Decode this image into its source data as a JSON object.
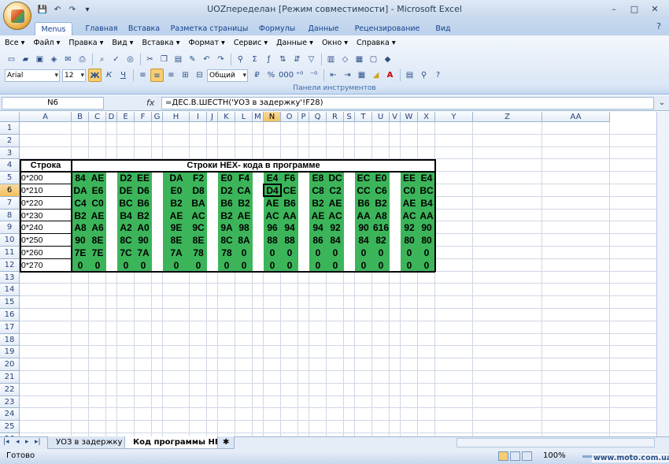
{
  "window": {
    "title": "UOZпеределан  [Режим совместимости] - Microsoft Excel",
    "minimize": "–",
    "maximize": "□",
    "close": "✕"
  },
  "qat": [
    "💾",
    "↶",
    "↷",
    "▾"
  ],
  "ribbon": {
    "tabs": [
      "Menus",
      "Главная",
      "Вставка",
      "Разметка страницы",
      "Формулы",
      "Данные",
      "Рецензирование",
      "Вид"
    ],
    "active_tab": "Menus",
    "help": "?",
    "menus": [
      "Все ▾",
      "Файл ▾",
      "Правка ▾",
      "Вид ▾",
      "Вставка ▾",
      "Формат ▾",
      "Сервис ▾",
      "Данные ▾",
      "Окно ▾",
      "Справка ▾"
    ],
    "font_name": "Arial",
    "font_size": "12",
    "number_format": "Общий",
    "group_label": "Панели инструментов"
  },
  "formula_bar": {
    "name_box": "N6",
    "fx": "fx",
    "formula": "=ДЕС.В.ШЕСТН('УОЗ в задержку'!F28)"
  },
  "grid": {
    "columns": [
      "A",
      "B",
      "C",
      "D",
      "E",
      "F",
      "G",
      "H",
      "I",
      "J",
      "K",
      "L",
      "M",
      "N",
      "O",
      "P",
      "Q",
      "R",
      "S",
      "T",
      "U",
      "V",
      "W",
      "X",
      "Y",
      "Z",
      "AA"
    ],
    "selected_column": "N",
    "rows": [
      "1",
      "2",
      "3",
      "4",
      "5",
      "6",
      "7",
      "8",
      "9",
      "10",
      "11",
      "12",
      "13",
      "14",
      "15",
      "16",
      "17",
      "18",
      "19",
      "20",
      "21",
      "22",
      "23",
      "24",
      "25",
      "26"
    ],
    "selected_row": "6",
    "header_row_label": "Строка",
    "header_title": "Строки HEX- кода в программе",
    "row_labels": [
      "0*200",
      "0*210",
      "0*220",
      "0*230",
      "0*240",
      "0*250",
      "0*260",
      "0*270"
    ],
    "hex_rows": [
      [
        "84",
        "AE",
        "D2",
        "EE",
        "DA",
        "F2",
        "E0",
        "F4",
        "E4",
        "F6",
        "E8",
        "DC",
        "EC",
        "E0",
        "EE",
        "E4"
      ],
      [
        "DA",
        "E6",
        "DE",
        "D6",
        "E0",
        "D8",
        "D2",
        "CA",
        "D4",
        "CE",
        "C8",
        "C2",
        "CC",
        "C6",
        "C0",
        "BC"
      ],
      [
        "C4",
        "C0",
        "BC",
        "B6",
        "B2",
        "BA",
        "B6",
        "B2",
        "AE",
        "B6",
        "B2",
        "AE",
        "B6",
        "B2",
        "AE",
        "B4"
      ],
      [
        "B2",
        "AE",
        "B4",
        "B2",
        "AE",
        "AC",
        "B2",
        "AE",
        "AC",
        "AA",
        "AE",
        "AC",
        "AA",
        "A8",
        "AC",
        "AA"
      ],
      [
        "A8",
        "A6",
        "A2",
        "A0",
        "9E",
        "9C",
        "9A",
        "98",
        "96",
        "94",
        "94",
        "92",
        "90",
        "616",
        "92",
        "90"
      ],
      [
        "90",
        "8E",
        "8C",
        "90",
        "8E",
        "8E",
        "8C",
        "8A",
        "88",
        "88",
        "86",
        "84",
        "84",
        "82",
        "80",
        "80"
      ],
      [
        "7E",
        "7E",
        "7C",
        "7A",
        "7A",
        "78",
        "78",
        "0",
        "0",
        "0",
        "0",
        "0",
        "0",
        "0",
        "0",
        "0"
      ],
      [
        "0",
        "0",
        "0",
        "0",
        "0",
        "0",
        "0",
        "0",
        "0",
        "0",
        "0",
        "0",
        "0",
        "0",
        "0",
        "0"
      ]
    ],
    "fill_color": "#3cb55a"
  },
  "sheets": {
    "tabs": [
      "УОЗ в задержку",
      "Код программы HEX"
    ],
    "active": "Код программы HEX",
    "nav": [
      "|◂",
      "◂",
      "▸",
      "▸|"
    ]
  },
  "status": {
    "ready": "Готово",
    "zoom": "100%"
  },
  "watermark": "www.moto.com.ua"
}
